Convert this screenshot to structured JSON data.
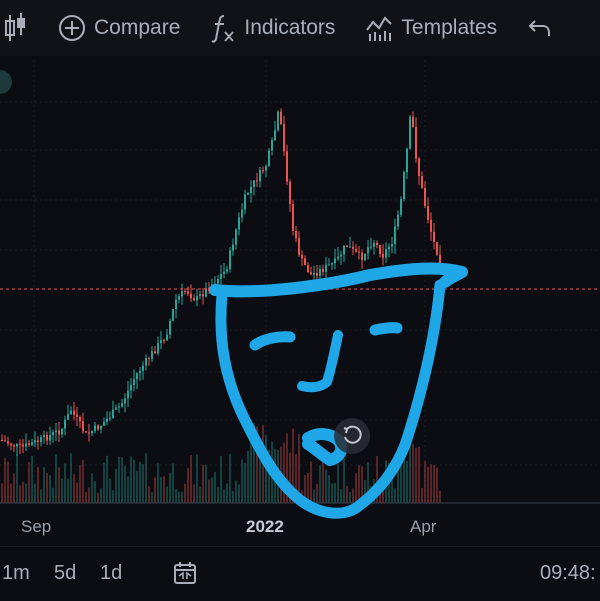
{
  "toolbar": {
    "compare_label": "Compare",
    "indicators_label": "Indicators",
    "templates_label": "Templates"
  },
  "xaxis": {
    "sep": "Sep",
    "year": "2022",
    "apr": "Apr"
  },
  "bottom": {
    "ranges": [
      "1m",
      "5d",
      "1d"
    ],
    "time": "09:48:"
  },
  "colors": {
    "bull": "#26a69a",
    "bear": "#ef5350",
    "drawing": "#1fa7e8",
    "price_line": "#ef5350"
  }
}
